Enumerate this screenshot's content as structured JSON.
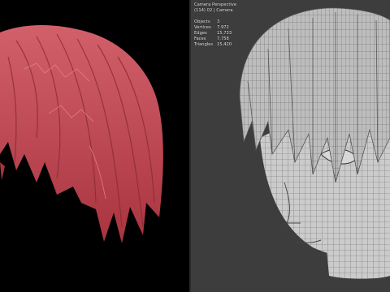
{
  "viewport_left": {
    "content": "hair-mesh-render"
  },
  "viewport_right": {
    "camera_label": "Camera Perspective",
    "scene_label": "(114) 02 | Camera",
    "stats": [
      {
        "label": "Objects",
        "value": "3"
      },
      {
        "label": "Vertices",
        "value": "7,972"
      },
      {
        "label": "Edges",
        "value": "15,733"
      },
      {
        "label": "Faces",
        "value": "7,758"
      },
      {
        "label": "Triangles",
        "value": "15,420"
      }
    ]
  },
  "colors": {
    "hair_red": "#c9505a",
    "hair_red_dark": "#8b2a34",
    "viewport_bg": "#3d3d3d",
    "mesh_gray": "#c9c9c9",
    "wire": "#5a5a5a"
  }
}
